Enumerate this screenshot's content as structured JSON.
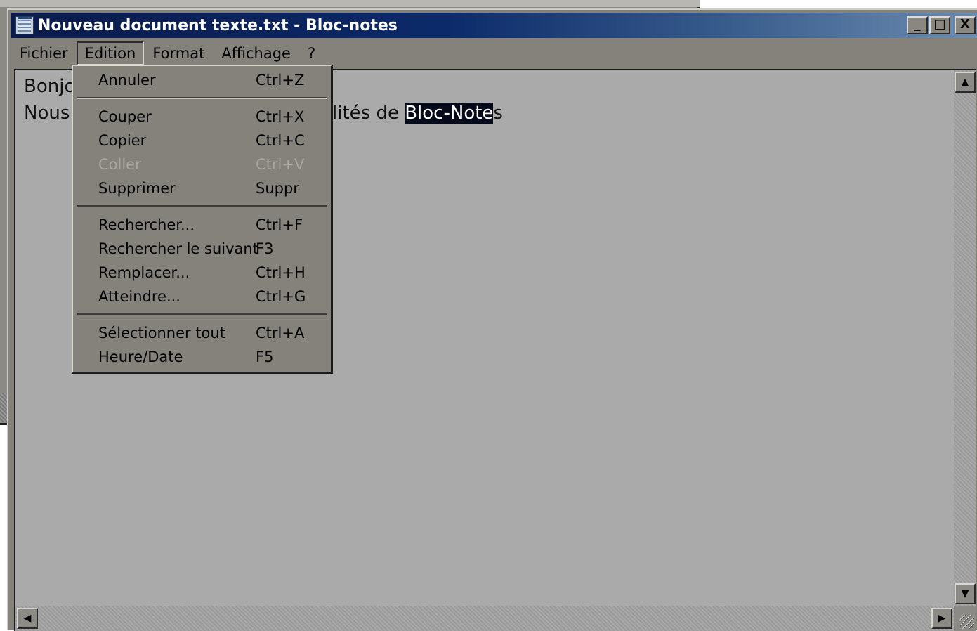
{
  "window": {
    "title": "Nouveau document texte.txt - Bloc-notes",
    "controls": {
      "minimize": "_",
      "maximize": "□",
      "close": "X"
    }
  },
  "menubar": {
    "items": [
      "Fichier",
      "Edition",
      "Format",
      "Affichage",
      "?"
    ],
    "active": "Edition"
  },
  "editor": {
    "line1_visible": "Bonjo",
    "line2_visible_left": "Nous",
    "line2_visible_right_plain": "lités de ",
    "line2_selected": "Bloc-Note",
    "line2_after_selection": "s"
  },
  "edit_menu": {
    "items": [
      {
        "label": "Annuler",
        "shortcut": "Ctrl+Z",
        "enabled": true
      },
      {
        "label": "Couper",
        "shortcut": "Ctrl+X",
        "enabled": true
      },
      {
        "label": "Copier",
        "shortcut": "Ctrl+C",
        "enabled": true
      },
      {
        "label": "Coller",
        "shortcut": "Ctrl+V",
        "enabled": false
      },
      {
        "label": "Supprimer",
        "shortcut": "Suppr",
        "enabled": true
      },
      {
        "label": "Rechercher...",
        "shortcut": "Ctrl+F",
        "enabled": true
      },
      {
        "label": "Rechercher le suivant",
        "shortcut": "F3",
        "enabled": true
      },
      {
        "label": "Remplacer...",
        "shortcut": "Ctrl+H",
        "enabled": true
      },
      {
        "label": "Atteindre...",
        "shortcut": "Ctrl+G",
        "enabled": true
      },
      {
        "label": "Sélectionner tout",
        "shortcut": "Ctrl+A",
        "enabled": true
      },
      {
        "label": "Heure/Date",
        "shortcut": "F5",
        "enabled": true
      }
    ]
  },
  "scrollbar_icons": {
    "up": "▲",
    "down": "▼",
    "left": "◀",
    "right": "▶"
  },
  "colors": {
    "titlebar_start": "#0a1a4a",
    "titlebar_end": "#6b8bb0",
    "selection_bg": "#050a1a",
    "menu_bg": "#85827c",
    "editor_bg": "#aaaaaa"
  }
}
